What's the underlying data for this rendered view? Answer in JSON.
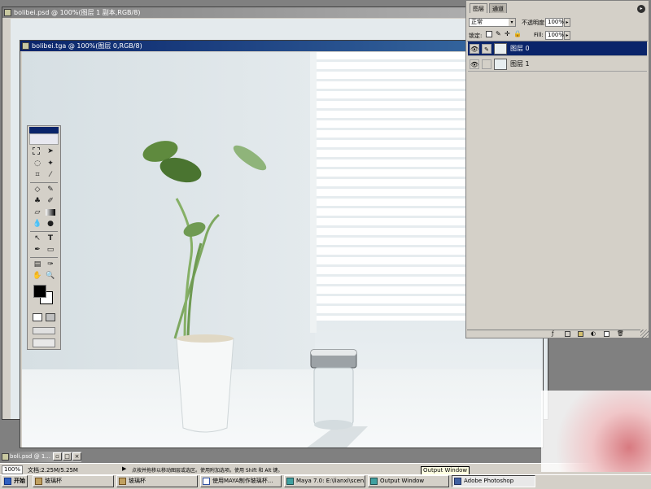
{
  "bg_window": {
    "title": "bolibei.psd @ 100%(图层 1 副本,RGB/8)"
  },
  "doc_window": {
    "title": "bolibei.tga @ 100%(图层 0,RGB/8)"
  },
  "layers_palette": {
    "tab_layers": "图层",
    "tab_channels": "通道",
    "blend_mode": "正常",
    "opacity_label": "不透明度:",
    "opacity_value": "100%",
    "lock_label": "锁定:",
    "fill_label": "Fill:",
    "fill_value": "100%",
    "layers": [
      {
        "name": "图层 0",
        "selected": true
      },
      {
        "name": "图层 1",
        "selected": false
      }
    ]
  },
  "minimized_doc": {
    "title": "boli.psd @ 1..."
  },
  "status_bar": {
    "zoom": "100%",
    "doc_size": "文档:2.25M/5.25M",
    "hint": "点按并拖移以移动图层或选区。使用附加选项。使用 Shift 和 Alt 键。"
  },
  "tooltip": {
    "text": "Output Window"
  },
  "taskbar": {
    "start_label": "开始",
    "items": [
      {
        "label": "玻璃杯",
        "active": false
      },
      {
        "label": "玻璃杯",
        "active": false
      },
      {
        "label": "使用MAYA制作玻璃杯...",
        "active": false
      },
      {
        "label": "Maya 7.0: E:\\lianxi\\scen...",
        "active": false
      },
      {
        "label": "Output Window",
        "active": false
      },
      {
        "label": "Adobe Photoshop",
        "active": true
      }
    ]
  },
  "colors": {
    "title_active": "#0a246a",
    "chrome": "#d4d0c8",
    "workspace": "#808080"
  }
}
